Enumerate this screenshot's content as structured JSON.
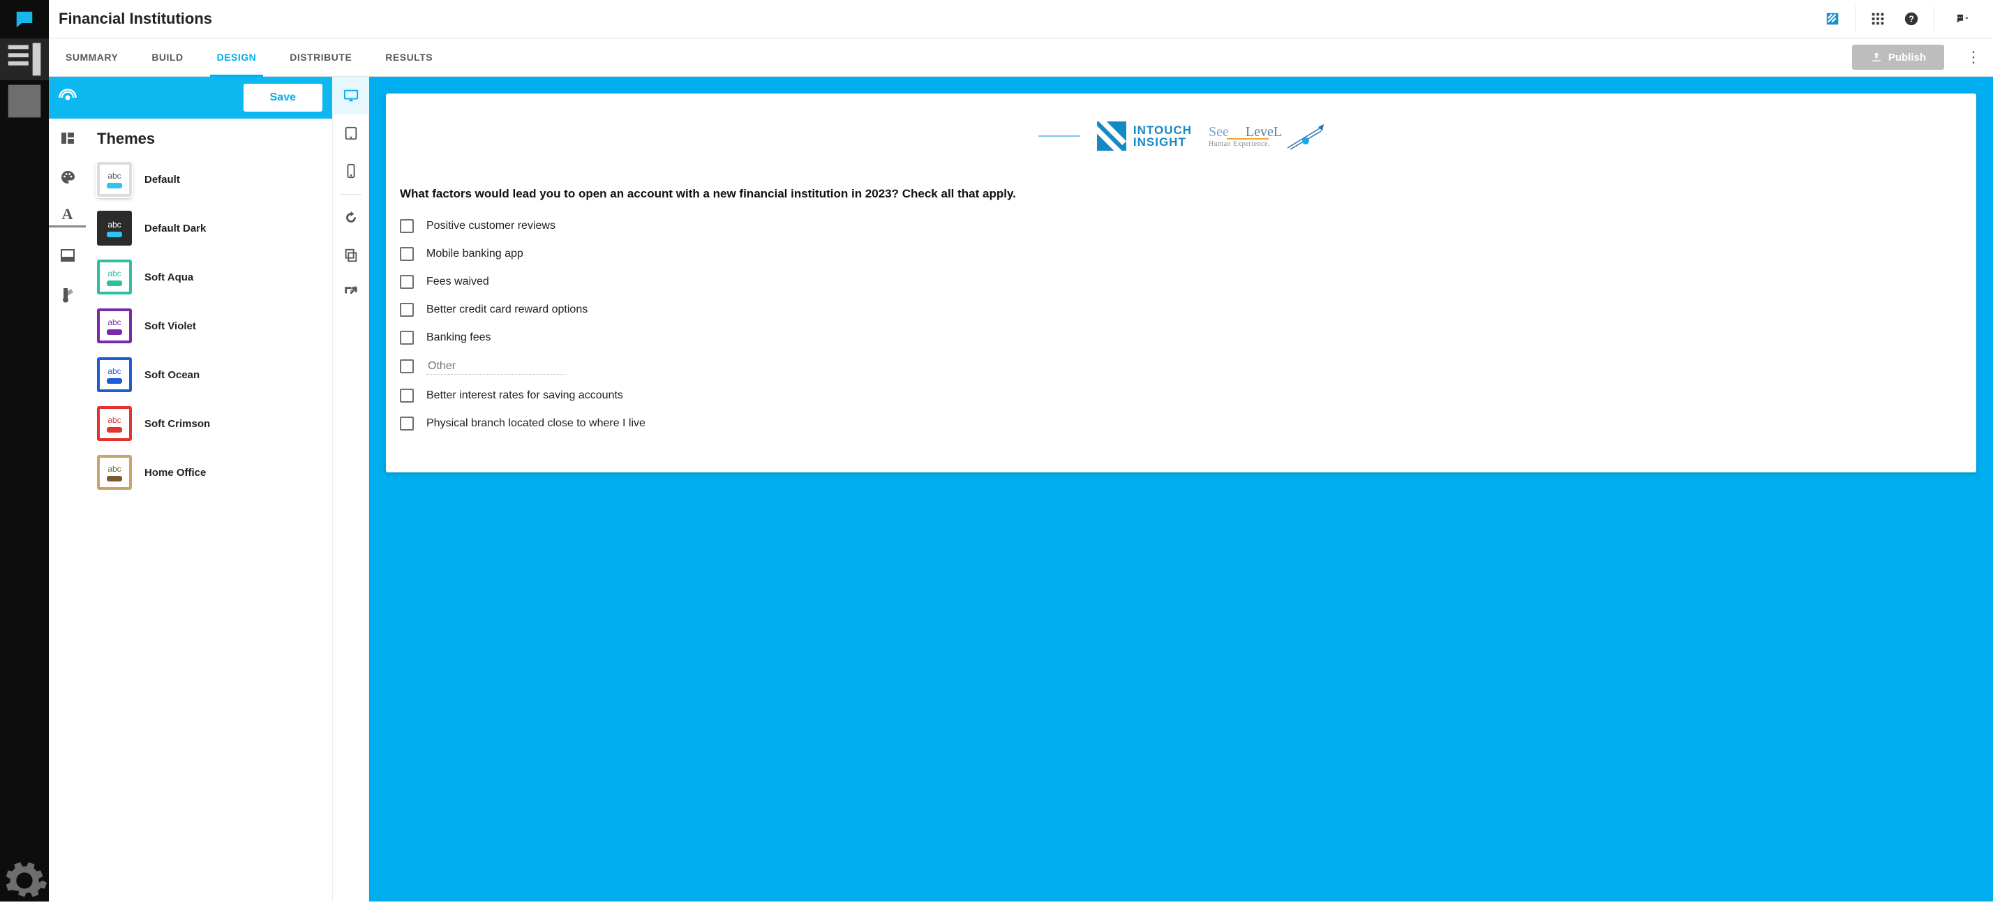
{
  "page": {
    "title": "Financial Institutions"
  },
  "tabs": [
    "SUMMARY",
    "BUILD",
    "DESIGN",
    "DISTRIBUTE",
    "RESULTS"
  ],
  "activeTab": 2,
  "actions": {
    "publish": "Publish",
    "save": "Save"
  },
  "themes": {
    "heading": "Themes",
    "selectedIndex": 0,
    "items": [
      {
        "label": "Default",
        "bg": "#ffffff",
        "border": "#dddddd",
        "text": "#555555",
        "bar": "#2fc3f0"
      },
      {
        "label": "Default Dark",
        "bg": "#2b2b2b",
        "border": "#2b2b2b",
        "text": "#ffffff",
        "bar": "#2fc3f0"
      },
      {
        "label": "Soft Aqua",
        "bg": "#ffffff",
        "border": "#2bbfa3",
        "text": "#2bbfa3",
        "bar": "#2bbfa3"
      },
      {
        "label": "Soft Violet",
        "bg": "#ffffff",
        "border": "#7a2aa8",
        "text": "#7a2aa8",
        "bar": "#7a2aa8"
      },
      {
        "label": "Soft Ocean",
        "bg": "#ffffff",
        "border": "#1e5bd6",
        "text": "#1e5bd6",
        "bar": "#1e5bd6"
      },
      {
        "label": "Soft Crimson",
        "bg": "#ffffff",
        "border": "#e2332f",
        "text": "#e2332f",
        "bar": "#e2332f"
      },
      {
        "label": "Home Office",
        "bg": "#ffffff",
        "border": "#c9a36a",
        "text": "#7a5a36",
        "bar": "#7a5a36"
      }
    ]
  },
  "preview": {
    "logo1": {
      "line1": "INTOUCH",
      "line2": "INSIGHT"
    },
    "logo2": {
      "see": "See",
      "level": "LeveL",
      "sub": "Human Experience."
    },
    "question": "What factors would lead you to open an account with a new financial institution in 2023? Check all that apply.",
    "options": [
      "Positive customer reviews",
      "Mobile banking app",
      "Fees waived",
      "Better credit card reward options",
      "Banking fees"
    ],
    "other_placeholder": "Other",
    "tail_options": [
      "Better interest rates for saving accounts",
      "Physical branch located close to where I live"
    ]
  },
  "farLeftRail": {
    "items": [
      "library",
      "contacts"
    ],
    "bottom": "settings"
  },
  "leftIconRail": {
    "items": [
      "target",
      "layout",
      "palette",
      "font",
      "footer",
      "style"
    ]
  },
  "deviceRail": {
    "items": [
      "desktop",
      "tablet",
      "phone",
      "reload",
      "copy",
      "open-external"
    ],
    "active": 0
  }
}
